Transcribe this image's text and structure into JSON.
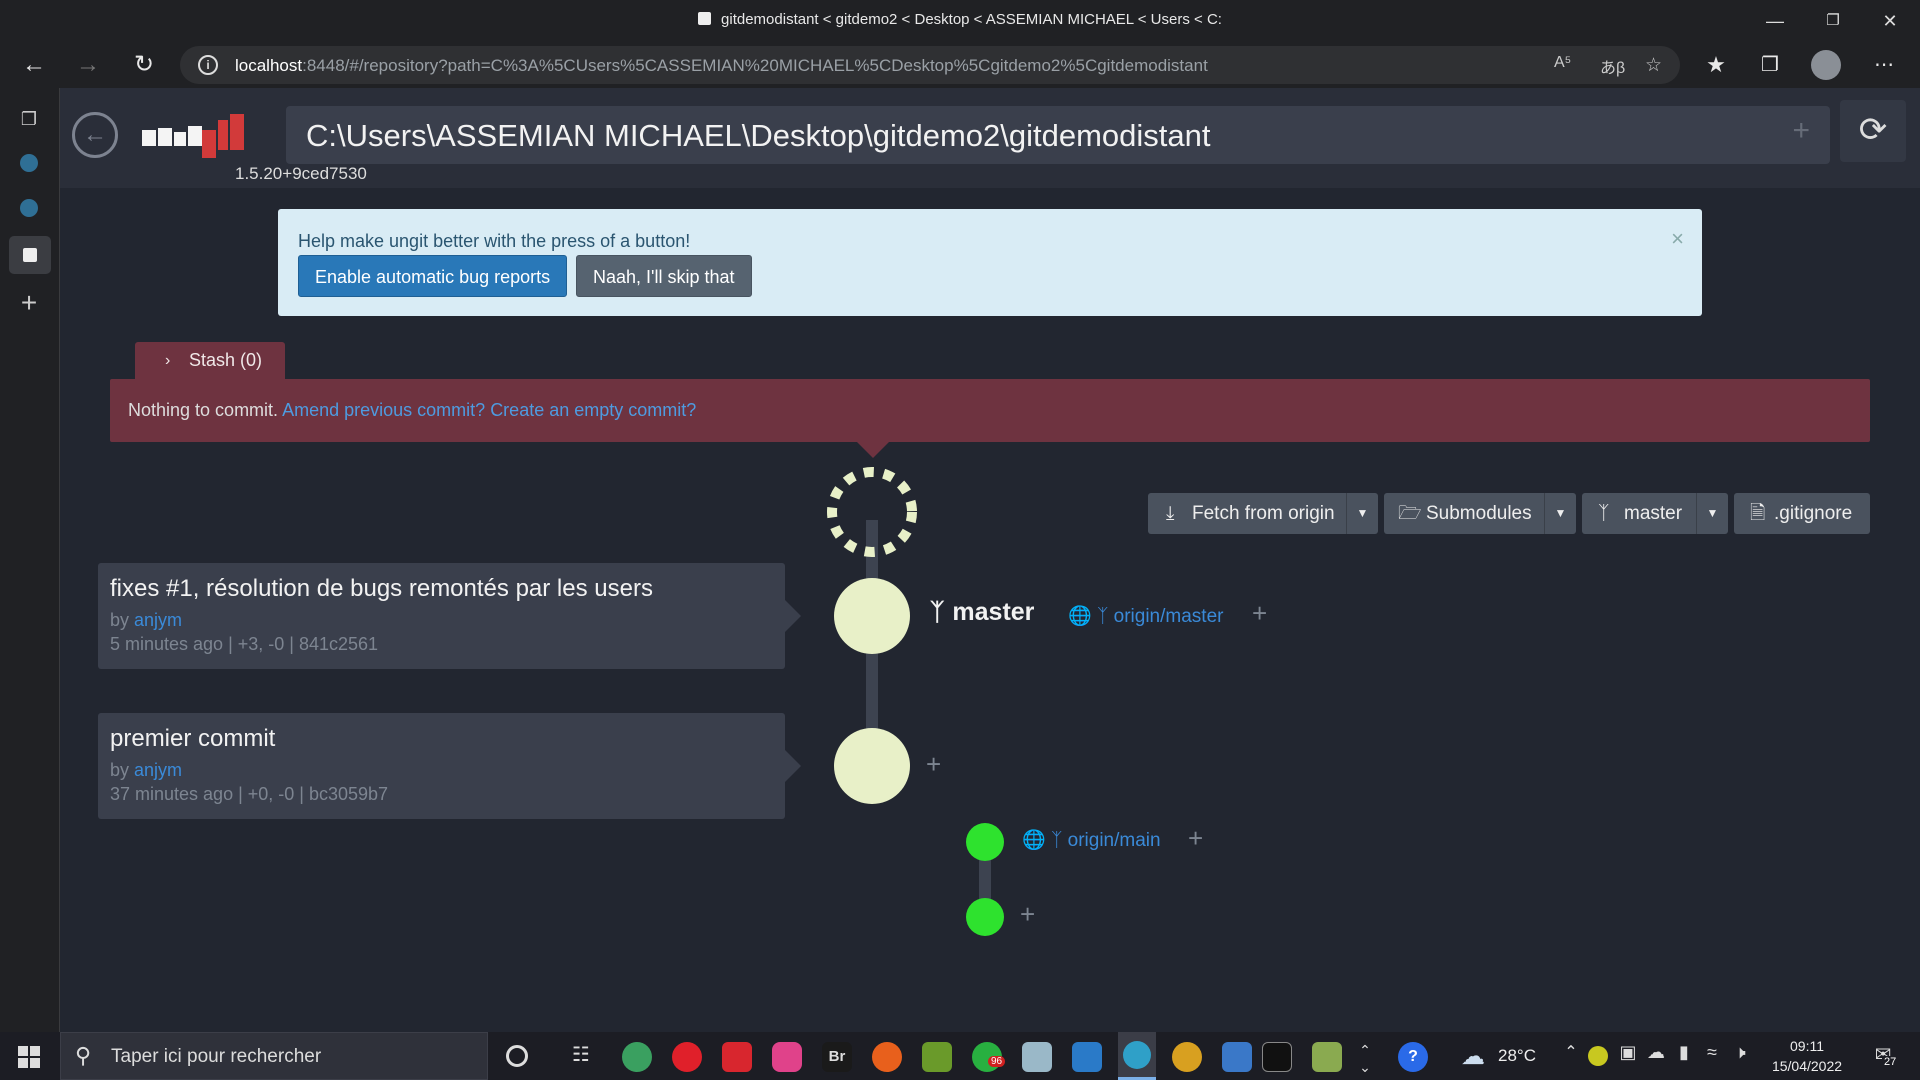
{
  "window": {
    "title": "gitdemodistant < gitdemo2 < Desktop < ASSEMIAN MICHAEL < Users < C:"
  },
  "browser": {
    "url_host": "localhost",
    "url_rest": ":8448/#/repository?path=C%3A%5CUsers%5CASSEMIAN%20MICHAEL%5CDesktop%5Cgitdemo2%5Cgitdemodistant",
    "read_aloud_icon": "A⁵"
  },
  "ungit": {
    "version": "1.5.20+9ced7530",
    "path": "C:\\Users\\ASSEMIAN MICHAEL\\Desktop\\gitdemo2\\gitdemodistant",
    "banner": {
      "message": "Help make ungit better with the press of a button!",
      "enable_label": "Enable automatic bug reports",
      "skip_label": "Naah, I'll skip that"
    },
    "stash_label": "Stash (0)",
    "nothing_to_commit": "Nothing to commit.",
    "amend_link": "Amend previous commit?",
    "empty_commit_link": "Create an empty commit?",
    "toolbar": {
      "fetch_label": "Fetch from origin",
      "submodules_label": "Submodules",
      "branch_label": "master",
      "gitignore_label": ".gitignore"
    },
    "commits": [
      {
        "title": "fixes #1, résolution de bugs remontés par les users",
        "by": "by",
        "author": "anjym",
        "meta": "5 minutes ago | +3, -0 | 841c2561"
      },
      {
        "title": "premier commit",
        "by": "by",
        "author": "anjym",
        "meta": "37 minutes ago | +0, -0 | bc3059b7"
      }
    ],
    "refs": {
      "local_branch": "master",
      "remote_master": "origin/master",
      "remote_main": "origin/main"
    },
    "colors": {
      "node_local": "#e8f0c8",
      "node_remote": "#2ee22e",
      "accent_link": "#3a8ad8",
      "commit_bar": "#6e3340"
    }
  },
  "taskbar": {
    "search_placeholder": "Taper ici pour rechercher",
    "temperature": "28°C",
    "time": "09:11",
    "date": "15/04/2022",
    "notification_count": "27",
    "whatsapp_badge": "96"
  }
}
